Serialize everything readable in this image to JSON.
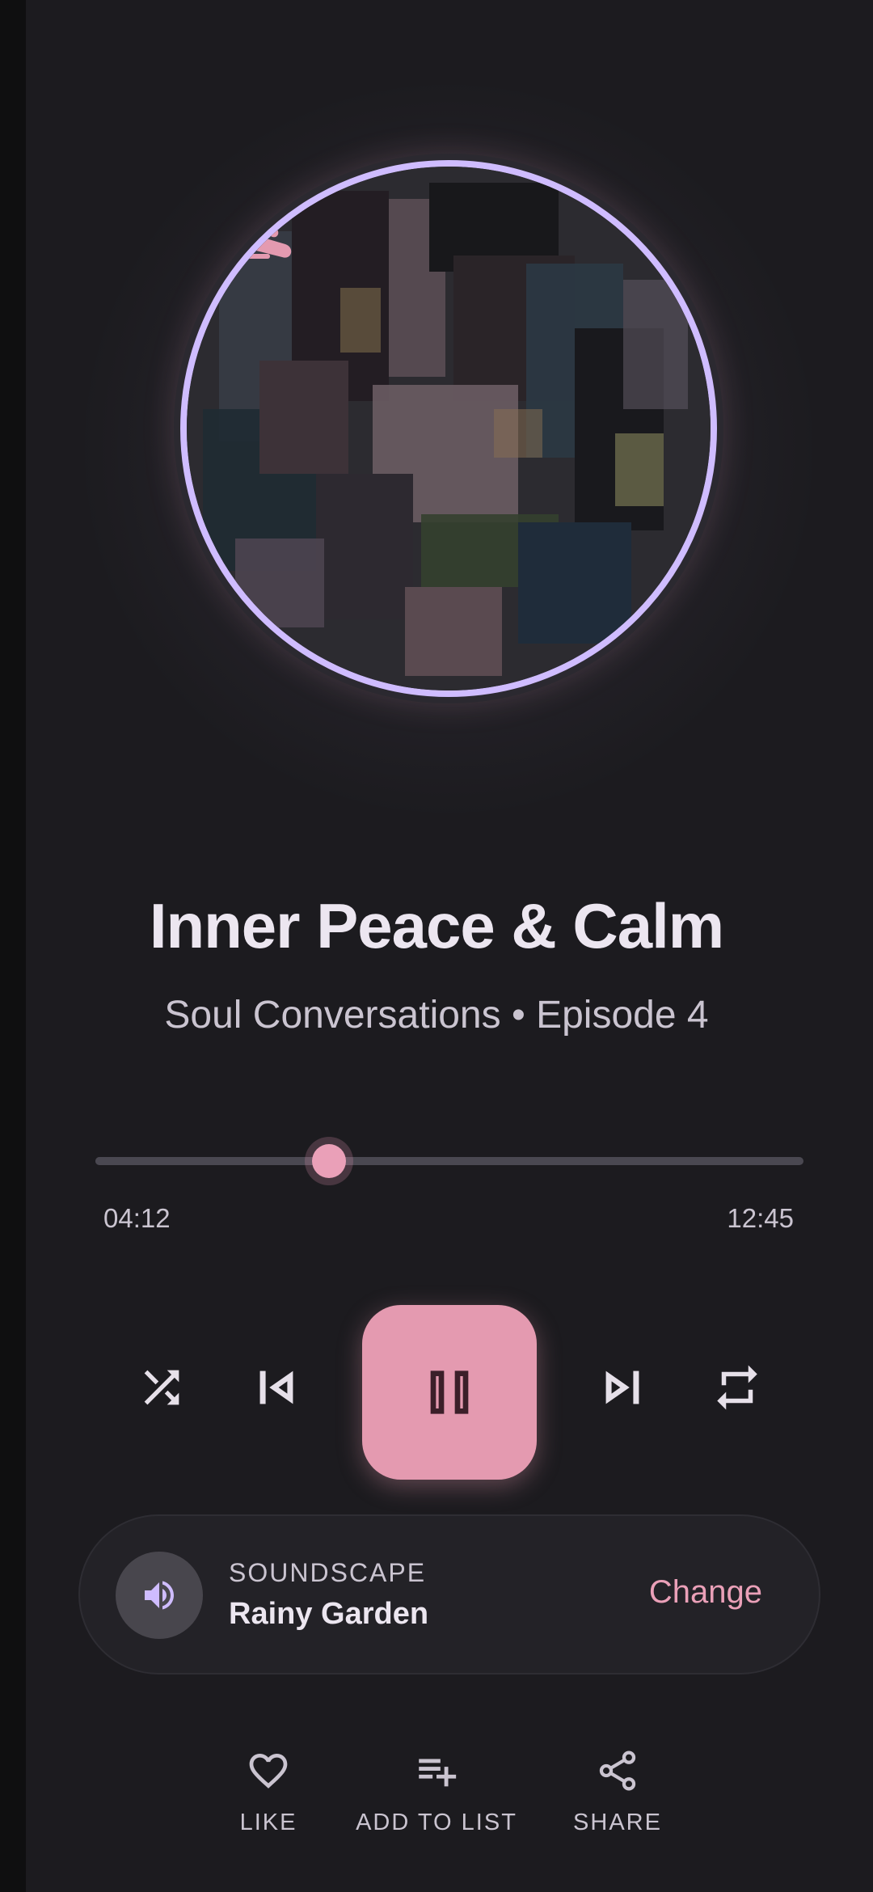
{
  "track": {
    "title": "Inner Peace & Calm",
    "subtitle": "Soul Conversations • Episode 4"
  },
  "playback": {
    "current_time": "04:12",
    "total_time": "12:45",
    "progress": 0.33,
    "state": "playing"
  },
  "controls": {
    "shuffle_icon": "shuffle-icon",
    "previous_icon": "skip-previous-icon",
    "pause_icon": "pause-icon",
    "next_icon": "skip-next-icon",
    "repeat_icon": "repeat-icon"
  },
  "soundscape": {
    "label": "SOUNDSCAPE",
    "name": "Rainy Garden",
    "change_label": "Change",
    "icon": "volume-icon"
  },
  "actions": [
    {
      "label": "LIKE",
      "icon": "heart-icon"
    },
    {
      "label": "ADD TO LIST",
      "icon": "playlist-add-icon"
    },
    {
      "label": "SHARE",
      "icon": "share-icon"
    }
  ],
  "colors": {
    "background": "#1c1b1f",
    "accent_pink": "#e49ab0",
    "ring_lavender": "#cfbcff",
    "text_primary": "#ece6f0",
    "text_secondary": "#cac4d0"
  }
}
